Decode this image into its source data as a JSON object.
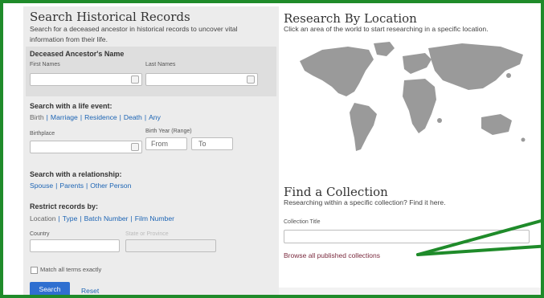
{
  "search": {
    "title": "Search Historical Records",
    "description": "Search for a deceased ancestor in historical records to uncover vital information from their life.",
    "ancestor": {
      "heading": "Deceased Ancestor's Name",
      "first_names_label": "First Names",
      "first_names_value": "",
      "last_names_label": "Last Names",
      "last_names_value": ""
    },
    "life_event": {
      "heading": "Search with a life event:",
      "selected": "Birth",
      "options": [
        "Marriage",
        "Residence",
        "Death",
        "Any"
      ],
      "birthplace_label": "Birthplace",
      "birthplace_value": "",
      "birth_year_label": "Birth Year (Range)",
      "from_placeholder": "From",
      "to_placeholder": "To"
    },
    "relationship": {
      "heading": "Search with a relationship:",
      "options": [
        "Spouse",
        "Parents",
        "Other Person"
      ]
    },
    "restrict": {
      "heading": "Restrict records by:",
      "selected": "Location",
      "options": [
        "Type",
        "Batch Number",
        "Film Number"
      ],
      "country_label": "Country",
      "country_value": "",
      "state_label": "State or Province",
      "state_value": ""
    },
    "match_exact_label": "Match all terms exactly",
    "match_exact_checked": false,
    "search_button": "Search",
    "reset_link": "Reset"
  },
  "location": {
    "title": "Research By Location",
    "description": "Click an area of the world to start researching in a specific location."
  },
  "collection": {
    "title": "Find a Collection",
    "description": "Researching within a specific collection? Find it here.",
    "collection_title_label": "Collection Title",
    "collection_title_value": "",
    "browse_link": "Browse all published collections"
  },
  "colors": {
    "border_annotation": "#1f8b2a",
    "link": "#1c64b4",
    "button": "#2f6fd0",
    "map_land": "#9a9a9a",
    "browse_link": "#7a2a3e"
  }
}
